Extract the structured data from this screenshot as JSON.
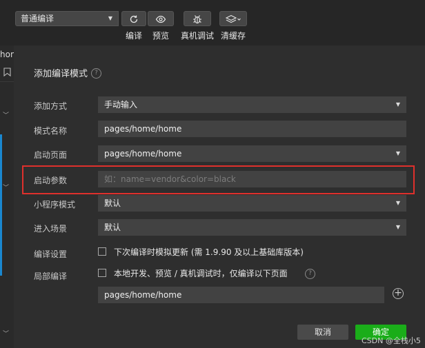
{
  "toolbar": {
    "mode_value": "普通编译",
    "buttons": [
      {
        "label": "编译",
        "icon": "refresh-icon"
      },
      {
        "label": "预览",
        "icon": "eye-icon"
      },
      {
        "label": "真机调试",
        "icon": "bug-icon"
      },
      {
        "label": "清缓存",
        "icon": "layers-icon"
      }
    ]
  },
  "left_panel": {
    "partial_text": "hon"
  },
  "dialog": {
    "title": "添加编译模式",
    "rows": {
      "add_method": {
        "label": "添加方式",
        "value": "手动输入"
      },
      "mode_name": {
        "label": "模式名称",
        "value": "pages/home/home"
      },
      "start_page": {
        "label": "启动页面",
        "value": "pages/home/home"
      },
      "start_params": {
        "label": "启动参数",
        "placeholder": "如：name=vendor&color=black"
      },
      "miniprogram_mode": {
        "label": "小程序模式",
        "value": "默认"
      },
      "enter_scene": {
        "label": "进入场景",
        "value": "默认"
      },
      "compile_settings": {
        "label": "编译设置",
        "checkbox_text": "下次编译时模拟更新 (需 1.9.90 及以上基础库版本)"
      },
      "partial_compile": {
        "label": "局部编译",
        "checkbox_text": "本地开发、预览 / 真机调试时，仅编译以下页面"
      }
    },
    "partial_page_value": "pages/home/home",
    "cancel_label": "取消",
    "ok_label": "确定"
  },
  "watermark": "CSDN @全栈小5",
  "colors": {
    "ok_button": "#1aad19",
    "highlight_box": "#e0302c",
    "left_accent": "#1a88d0"
  }
}
